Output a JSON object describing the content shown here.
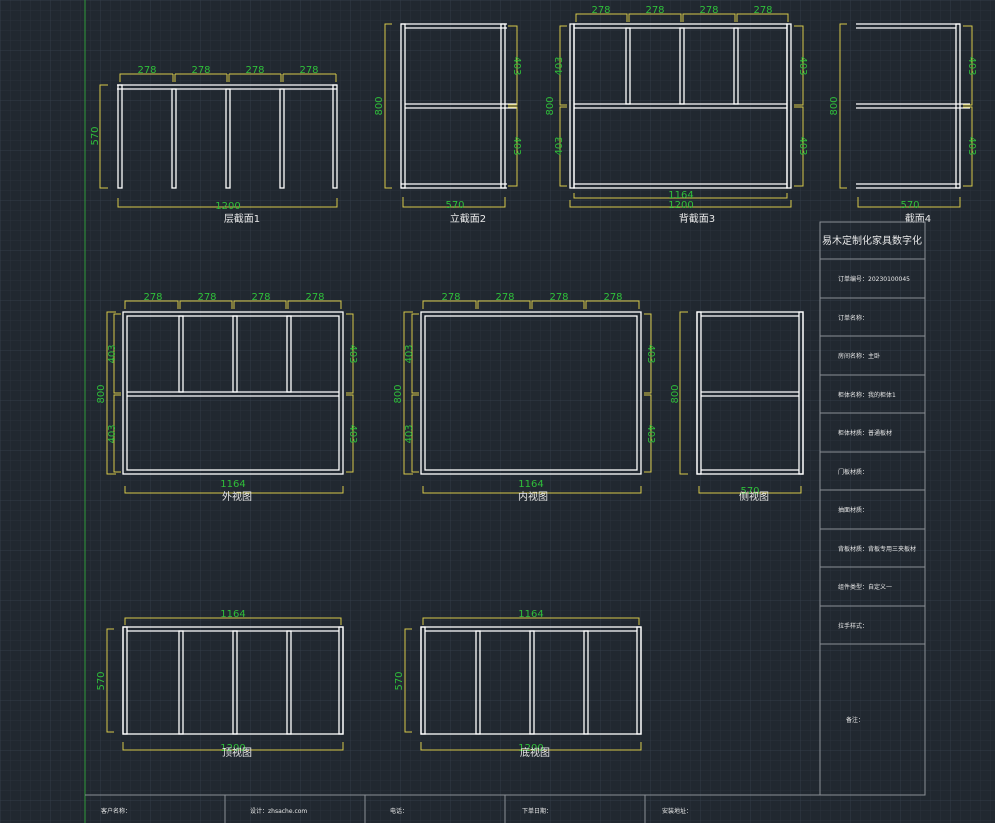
{
  "colors": {
    "background": "#212830",
    "grid_minor": "#2a323c",
    "grid_major": "#343d48",
    "outline": "#ffffff",
    "dimension": "#d6c94a",
    "dimension_text": "#2fbf3a",
    "frame": "#8a8f96",
    "axis": "#2f9a3a",
    "label": "#e8e8e8"
  },
  "views": {
    "v1": {
      "title": "层截面1",
      "top_dims": [
        "278",
        "278",
        "278",
        "278"
      ],
      "width": "1200",
      "height": "570"
    },
    "v2": {
      "title": "立截面2",
      "height": "800",
      "right_dims": [
        "403",
        "403"
      ],
      "width": "570"
    },
    "v3": {
      "title": "背截面3",
      "top_dims": [
        "278",
        "278",
        "278",
        "278"
      ],
      "left_dims": [
        "403",
        "403"
      ],
      "height": "800",
      "right_dims": [
        "403",
        "403"
      ],
      "inner_width": "1164",
      "width": "1200"
    },
    "v4": {
      "title": "截面4",
      "height": "800",
      "right_dims": [
        "403",
        "403"
      ],
      "width": "570"
    },
    "v5": {
      "title": "外视图",
      "top_dims": [
        "278",
        "278",
        "278",
        "278"
      ],
      "left_dims": [
        "403",
        "403"
      ],
      "height": "800",
      "right_dims": [
        "403",
        "403"
      ],
      "width": "1164"
    },
    "v6": {
      "title": "内视图",
      "top_dims": [
        "278",
        "278",
        "278",
        "278"
      ],
      "left_dims": [
        "403",
        "403"
      ],
      "height": "800",
      "right_dims": [
        "403",
        "403"
      ],
      "width": "1164"
    },
    "v7": {
      "title": "侧视图",
      "height": "800",
      "width": "570"
    },
    "v8": {
      "title": "顶视图",
      "top_width": "1164",
      "height": "570",
      "bottom_width": "1200"
    },
    "v9": {
      "title": "底视图",
      "top_width": "1164",
      "height": "570",
      "bottom_width": "1200"
    }
  },
  "title_block": {
    "company": "易木定制化家具数字化",
    "rows": [
      "订单编号：20230100045",
      "订单名称：",
      "房间名称：主卧",
      "柜体名称：我的柜体1",
      "柜体材质：普通板材",
      "门板材质：",
      "抽面材质：",
      "背板材质：背板专用三夹板材",
      "组件类型：自定义一",
      "拉手样式："
    ],
    "notes_label": "备注："
  },
  "footer": [
    "客户名称：",
    "设计：zhsache.com",
    "电话：",
    "下单日期：",
    "安装地址："
  ]
}
